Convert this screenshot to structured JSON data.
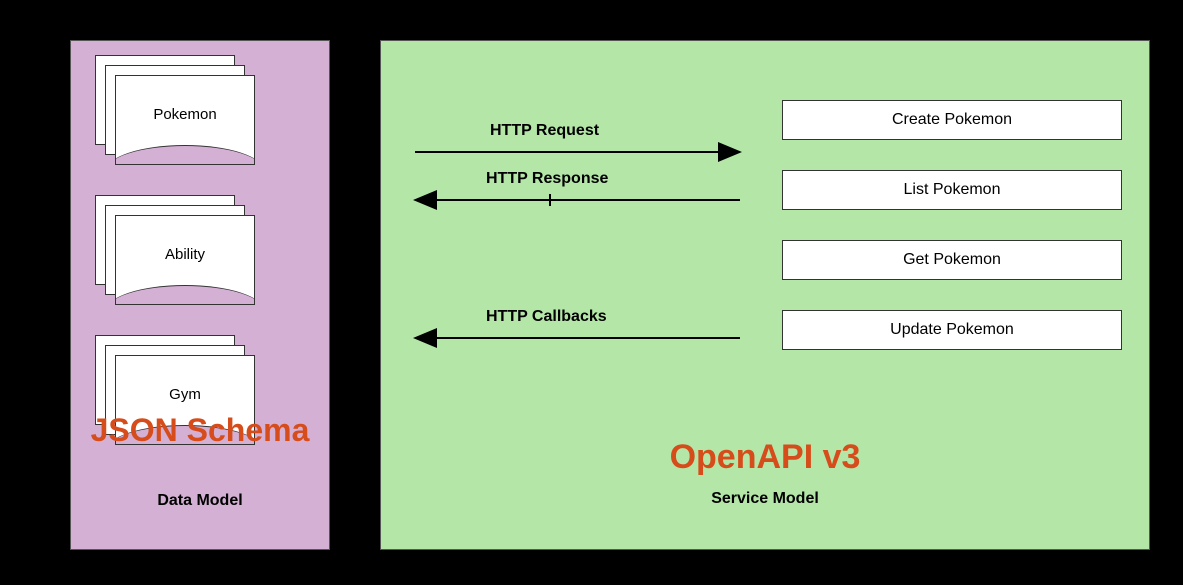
{
  "data_model": {
    "title": "JSON Schema",
    "subtitle": "Data Model",
    "schemas": [
      {
        "label": "Pokemon"
      },
      {
        "label": "Ability"
      },
      {
        "label": "Gym"
      }
    ]
  },
  "service_model": {
    "title": "OpenAPI v3",
    "subtitle": "Service Model",
    "endpoints": [
      {
        "label": "Create Pokemon"
      },
      {
        "label": "List Pokemon"
      },
      {
        "label": "Get Pokemon"
      },
      {
        "label": "Update Pokemon"
      }
    ]
  },
  "arrows": {
    "request": "HTTP Request",
    "response": "HTTP Response",
    "callbacks": "HTTP Callbacks"
  }
}
